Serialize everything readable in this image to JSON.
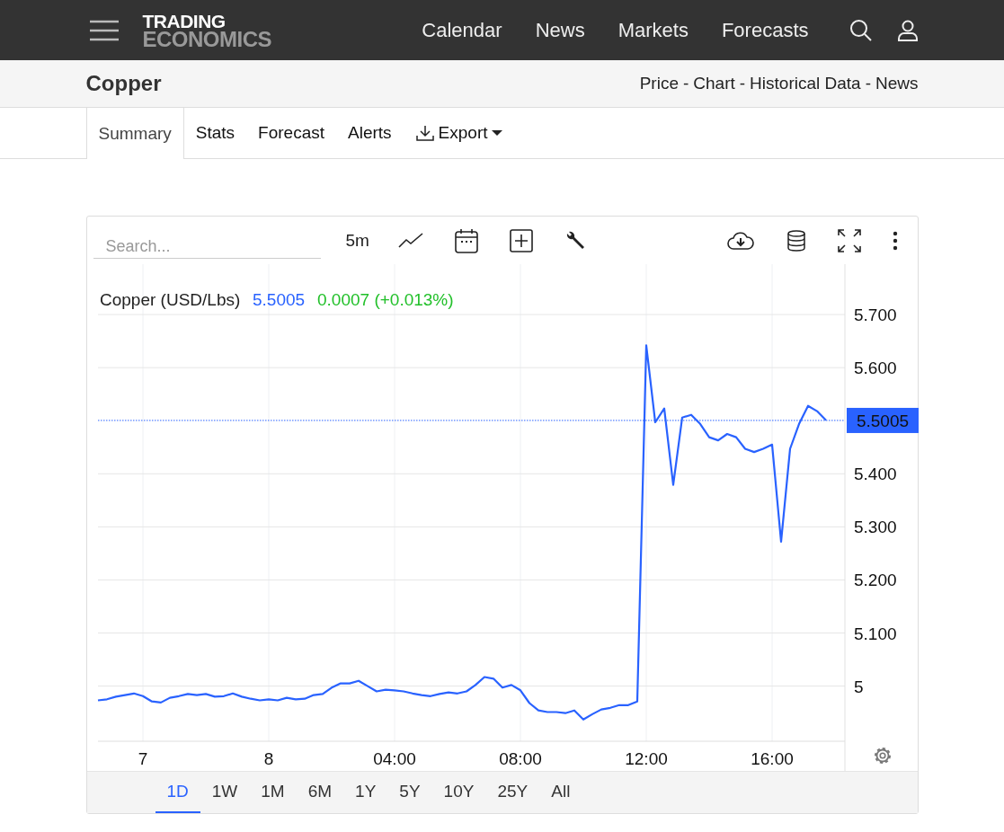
{
  "header": {
    "logo": {
      "line1": "TRADING",
      "line2": "ECONOMICS"
    },
    "nav": [
      "Calendar",
      "News",
      "Markets",
      "Forecasts"
    ]
  },
  "title_bar": {
    "title": "Copper",
    "links": [
      "Price",
      "Chart",
      "Historical Data",
      "News"
    ],
    "separator": "-"
  },
  "tabs": [
    {
      "label": "Summary",
      "selected": true
    },
    {
      "label": "Stats",
      "selected": false
    },
    {
      "label": "Forecast",
      "selected": false
    },
    {
      "label": "Alerts",
      "selected": false
    },
    {
      "label": "Export",
      "selected": false,
      "kind": "dropdown"
    }
  ],
  "chart_toolbar": {
    "search": {
      "placeholder": "Search..."
    },
    "interval": "5m"
  },
  "legend": {
    "price": "5.5005",
    "change": "0.0007 (+0.013%)"
  },
  "last_price_label": "5.5005",
  "chart_data": {
    "type": "line",
    "grid": true,
    "categories": [
      null,
      null,
      null,
      null,
      null,
      "7",
      null,
      null,
      null,
      null,
      null,
      null,
      null,
      null,
      null,
      null,
      null,
      null,
      null,
      "8",
      null,
      null,
      null,
      null,
      null,
      null,
      null,
      null,
      null,
      null,
      null,
      null,
      null,
      "04:00",
      null,
      null,
      null,
      null,
      null,
      null,
      null,
      null,
      null,
      null,
      null,
      null,
      null,
      "08:00",
      null,
      null,
      null,
      null,
      null,
      null,
      null,
      null,
      null,
      null,
      null,
      null,
      null,
      "12:00",
      null,
      null,
      null,
      null,
      null,
      null,
      null,
      null,
      null,
      null,
      null,
      null,
      null,
      "16:00",
      null,
      null,
      null,
      null,
      null,
      null
    ],
    "series": [
      {
        "name": "Copper (USD/Lbs)",
        "color": "#2962ff",
        "values": [
          4.973,
          4.975,
          4.98,
          4.983,
          4.986,
          4.981,
          4.971,
          4.969,
          4.978,
          4.981,
          4.985,
          4.983,
          4.985,
          4.98,
          4.981,
          4.986,
          4.98,
          4.976,
          4.973,
          4.975,
          4.973,
          4.978,
          4.975,
          4.976,
          4.983,
          4.985,
          4.997,
          5.005,
          5.005,
          5.01,
          5.0,
          4.99,
          4.993,
          4.992,
          4.99,
          4.986,
          4.983,
          4.981,
          4.985,
          4.988,
          4.986,
          4.99,
          5.002,
          5.017,
          5.014,
          4.997,
          5.002,
          4.992,
          4.968,
          4.954,
          4.951,
          4.951,
          4.949,
          4.954,
          4.937,
          4.947,
          4.956,
          4.959,
          4.964,
          4.964,
          4.971,
          5.642,
          5.497,
          5.523,
          5.379,
          5.506,
          5.511,
          5.494,
          5.469,
          5.463,
          5.475,
          5.469,
          5.447,
          5.441,
          5.447,
          5.455,
          5.272,
          5.447,
          5.494,
          5.528,
          5.518,
          5.501
        ]
      }
    ],
    "ylim": [
      4.896,
      5.795
    ],
    "yticks": [
      {
        "value": 5,
        "label": "5"
      },
      {
        "value": 5.1,
        "label": "5.100"
      },
      {
        "value": 5.2,
        "label": "5.200"
      },
      {
        "value": 5.3,
        "label": "5.300"
      },
      {
        "value": 5.4,
        "label": "5.400"
      },
      {
        "value": 5.6,
        "label": "5.600"
      },
      {
        "value": 5.7,
        "label": "5.700"
      }
    ],
    "ref_lines": [
      {
        "axis": "y",
        "value": 5.5005,
        "color": "#2962ff"
      }
    ]
  },
  "ranges": [
    {
      "label": "1D",
      "selected": true
    },
    {
      "label": "1W",
      "selected": false
    },
    {
      "label": "1M",
      "selected": false
    },
    {
      "label": "6M",
      "selected": false
    },
    {
      "label": "1Y",
      "selected": false
    },
    {
      "label": "5Y",
      "selected": false
    },
    {
      "label": "10Y",
      "selected": false
    },
    {
      "label": "25Y",
      "selected": false
    },
    {
      "label": "All",
      "selected": false
    }
  ]
}
